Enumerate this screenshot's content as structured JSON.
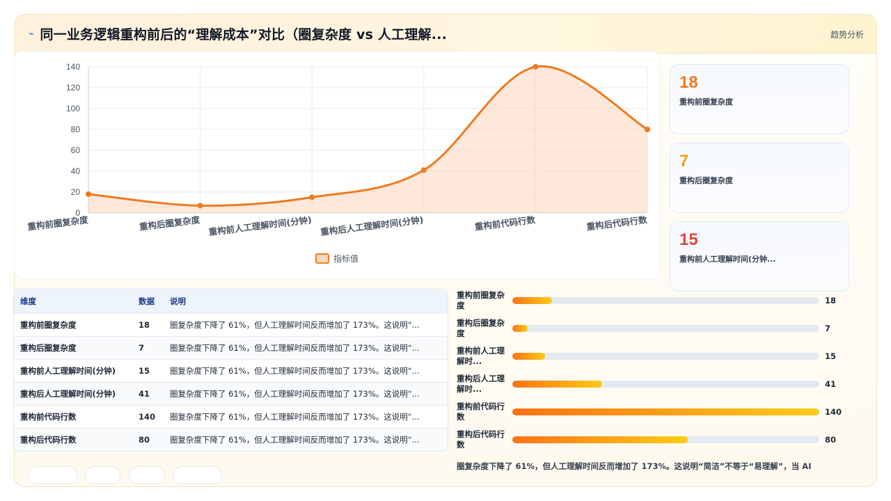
{
  "header": {
    "title": "同一业务逻辑重构前后的“理解成本”对比（圈复杂度 vs 人工理解...",
    "badge": "趋势分析"
  },
  "chart_data": {
    "type": "area",
    "categories": [
      "重构前圈复杂度",
      "重构后圈复杂度",
      "重构前人工理解时间(分钟)",
      "重构后人工理解时间(分钟)",
      "重构前代码行数",
      "重构后代码行数"
    ],
    "series": [
      {
        "name": "指标值",
        "values": [
          18,
          7,
          15,
          41,
          140,
          80
        ]
      }
    ],
    "ylim": [
      0,
      140
    ],
    "yticks": [
      0,
      20,
      40,
      60,
      80,
      100,
      120,
      140
    ],
    "grid": true,
    "legend": "bottom",
    "color": "#f07a1f"
  },
  "stats": [
    {
      "value": "18",
      "label": "重构前圈复杂度",
      "color": "#f07a1f"
    },
    {
      "value": "7",
      "label": "重构后圈复杂度",
      "color": "#f2a01a"
    },
    {
      "value": "15",
      "label": "重构前人工理解时间(分钟...",
      "color": "#e2453b"
    }
  ],
  "table": {
    "headers": [
      "维度",
      "数据",
      "说明"
    ],
    "rows": [
      [
        "重构前圈复杂度",
        "18",
        "圈复杂度下降了 61%，但人工理解时间反而增加了 173%。这说明“..."
      ],
      [
        "重构后圈复杂度",
        "7",
        "圈复杂度下降了 61%，但人工理解时间反而增加了 173%。这说明“..."
      ],
      [
        "重构前人工理解时间(分钟)",
        "15",
        "圈复杂度下降了 61%，但人工理解时间反而增加了 173%。这说明“..."
      ],
      [
        "重构后人工理解时间(分钟)",
        "41",
        "圈复杂度下降了 61%，但人工理解时间反而增加了 173%。这说明“..."
      ],
      [
        "重构前代码行数",
        "140",
        "圈复杂度下降了 61%，但人工理解时间反而增加了 173%。这说明“..."
      ],
      [
        "重构后代码行数",
        "80",
        "圈复杂度下降了 61%，但人工理解时间反而增加了 173%。这说明“..."
      ]
    ]
  },
  "bars": {
    "max": 140,
    "items": [
      {
        "label": "重构前圈复杂度",
        "value": 18
      },
      {
        "label": "重构后圈复杂度",
        "value": 7
      },
      {
        "label": "重构前人工理解时...",
        "value": 15
      },
      {
        "label": "重构后人工理解时...",
        "value": 41
      },
      {
        "label": "重构前代码行数",
        "value": 140
      },
      {
        "label": "重构后代码行数",
        "value": 80
      }
    ]
  },
  "note": "圈复杂度下降了 61%，但人工理解时间反而增加了 173%。这说明“简洁”不等于“易理解”，当 AI"
}
